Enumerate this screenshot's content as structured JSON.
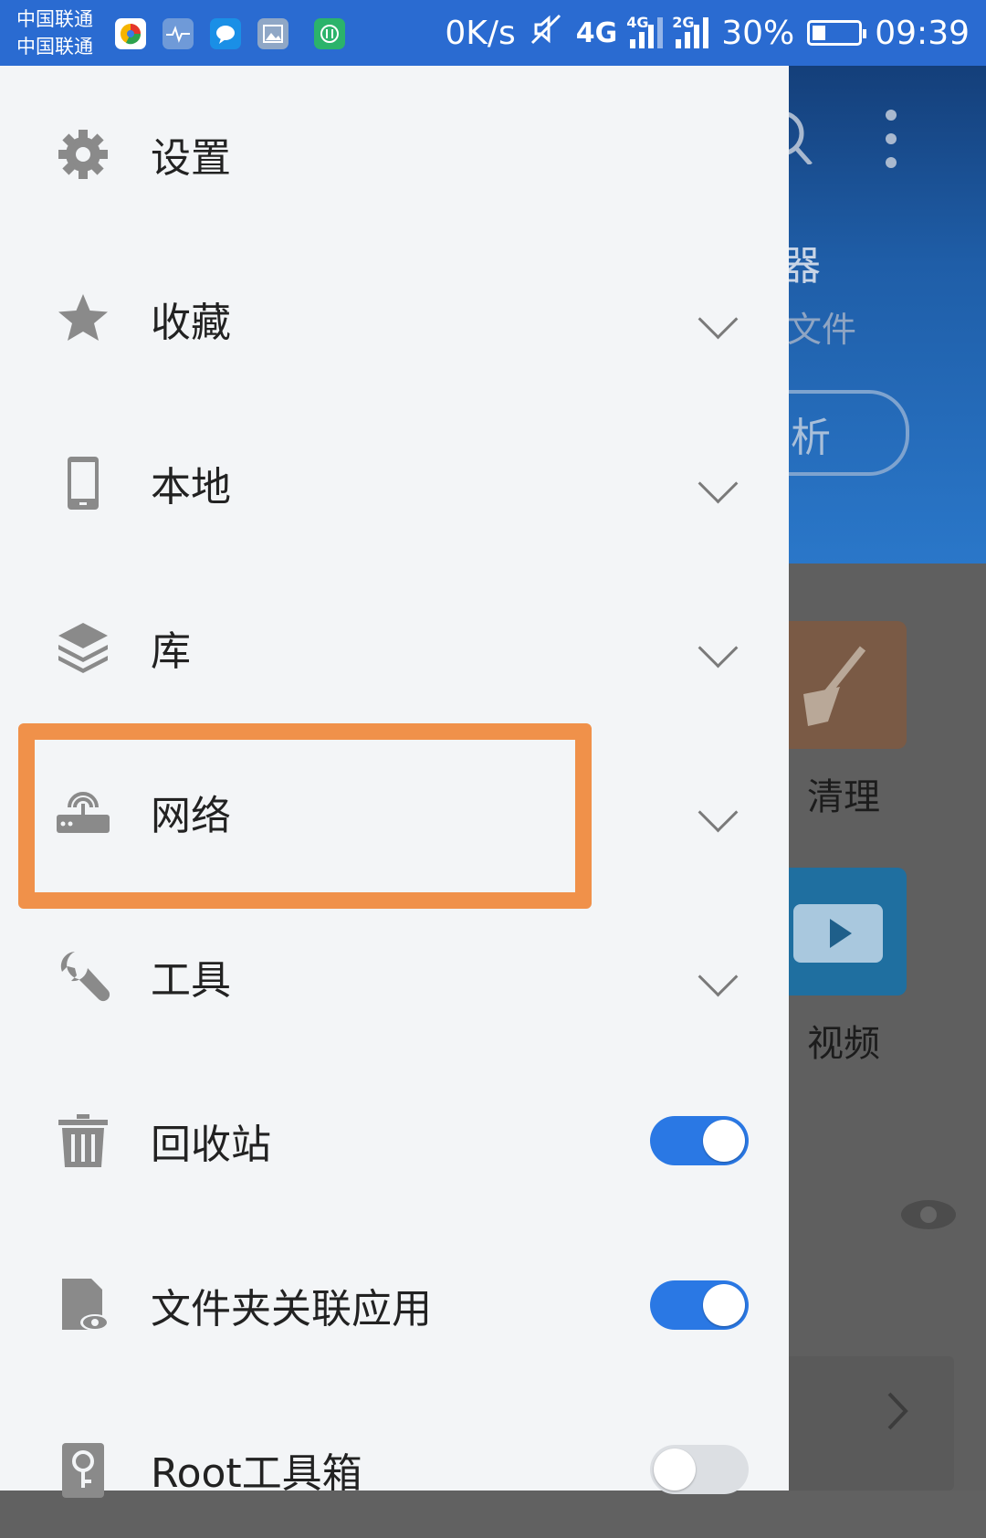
{
  "status_bar": {
    "carrier_1": "中国联通",
    "carrier_2": "中国联通",
    "speed": "0K/s",
    "net_1": "4G",
    "net_2": "4G",
    "net_3": "2G",
    "battery": "30%",
    "battery_level": 0.3,
    "time": "09:39",
    "notification_icons": [
      "browser-icon",
      "health-icon",
      "message-icon",
      "gallery-icon",
      "sync-icon"
    ]
  },
  "drawer": {
    "items": [
      {
        "label": "设置",
        "icon": "gear-icon",
        "control": "none"
      },
      {
        "label": "收藏",
        "icon": "star-icon",
        "control": "chevron"
      },
      {
        "label": "本地",
        "icon": "phone-icon",
        "control": "chevron"
      },
      {
        "label": "库",
        "icon": "layers-icon",
        "control": "chevron"
      },
      {
        "label": "网络",
        "icon": "router-icon",
        "control": "chevron"
      },
      {
        "label": "工具",
        "icon": "wrench-icon",
        "control": "chevron"
      },
      {
        "label": "回收站",
        "icon": "trash-icon",
        "control": "toggle",
        "toggle_on": true
      },
      {
        "label": "文件夹关联应用",
        "icon": "folder-eye-icon",
        "control": "toggle",
        "toggle_on": true
      },
      {
        "label": "Root工具箱",
        "icon": "root-key-icon",
        "control": "toggle",
        "toggle_on": false
      }
    ]
  },
  "background": {
    "title_partial": "器",
    "subtitle_partial": "文件",
    "button_partial": "析",
    "tile_1_label": "清理",
    "tile_2_label": "视频"
  },
  "colors": {
    "status_bar": "#2a6bd1",
    "toggle_on": "#2a78e4",
    "highlight": "#f0914a"
  }
}
